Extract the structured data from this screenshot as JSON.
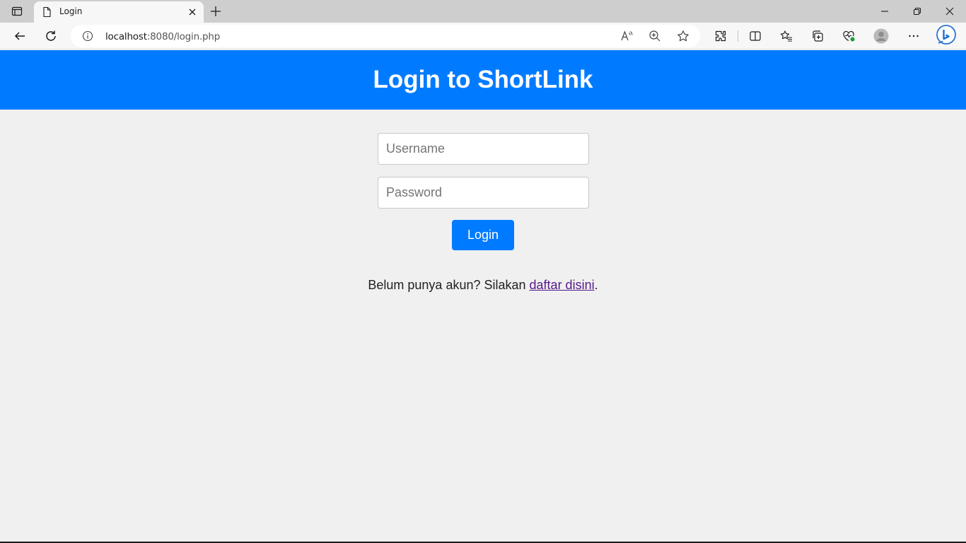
{
  "browser": {
    "tab": {
      "title": "Login"
    },
    "address": {
      "host": "localhost",
      "rest": ":8080/login.php"
    }
  },
  "page": {
    "heading": "Login to ShortLink",
    "form": {
      "username_placeholder": "Username",
      "password_placeholder": "Password",
      "submit_label": "Login"
    },
    "signup": {
      "prefix": "Belum punya akun? Silakan ",
      "link_text": "daftar disini",
      "suffix": "."
    }
  },
  "colors": {
    "brand_blue": "#007bff",
    "visited_link": "#551a8b",
    "page_background": "#f0f0f0"
  }
}
